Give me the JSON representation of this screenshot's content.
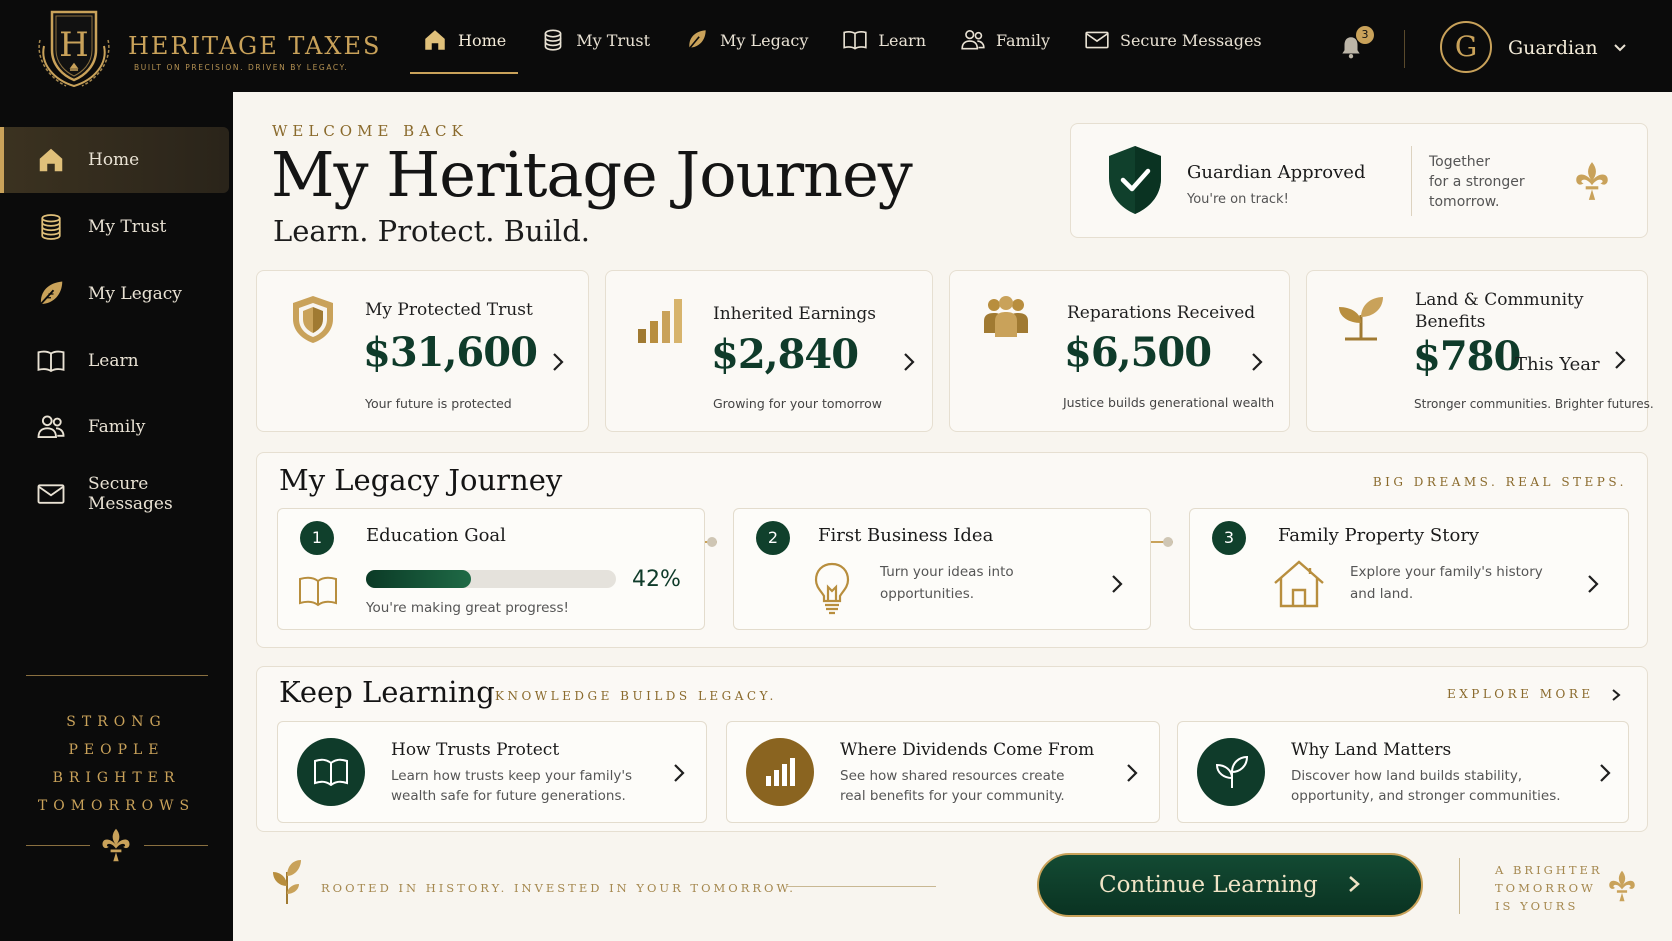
{
  "brand": {
    "letter": "H",
    "name": "HERITAGE TAXES",
    "tagline": "BUILT ON PRECISION. DRIVEN BY LEGACY."
  },
  "topnav": {
    "items": [
      {
        "label": "Home",
        "icon": "home-icon",
        "active": true
      },
      {
        "label": "My Trust",
        "icon": "coins-icon"
      },
      {
        "label": "My Legacy",
        "icon": "leaf-icon"
      },
      {
        "label": "Learn",
        "icon": "book-icon"
      },
      {
        "label": "Family",
        "icon": "family-icon"
      },
      {
        "label": "Secure Messages",
        "icon": "mail-icon"
      }
    ],
    "notification_count": "3",
    "user_initial": "G",
    "user_name": "Guardian"
  },
  "sidebar": {
    "items": [
      {
        "label": "Home",
        "icon": "home-icon",
        "active": true
      },
      {
        "label": "My Trust",
        "icon": "coins-icon"
      },
      {
        "label": "My Legacy",
        "icon": "leaf-icon"
      },
      {
        "label": "Learn",
        "icon": "book-icon"
      },
      {
        "label": "Family",
        "icon": "family-icon"
      },
      {
        "label": "Secure Messages",
        "icon": "mail-icon"
      }
    ],
    "motto": [
      "STRONG",
      "PEOPLE",
      "BRIGHTER",
      "TOMORROWS"
    ]
  },
  "header": {
    "eyebrow": "WELCOME BACK",
    "title": "My Heritage Journey",
    "subtitle": "Learn. Protect. Build."
  },
  "approved": {
    "title": "Guardian Approved",
    "subtitle": "You're on track!",
    "motto": [
      "Together",
      "for a stronger",
      "tomorrow."
    ]
  },
  "stats": [
    {
      "label": "My Protected Trust",
      "value": "$31,600",
      "caption": "Your future is protected",
      "icon": "shield-icon"
    },
    {
      "label": "Inherited Earnings",
      "value": "$2,840",
      "caption": "Growing for your tomorrow",
      "icon": "bar-chart-icon"
    },
    {
      "label": "Reparations Received",
      "value": "$6,500",
      "caption": "Justice builds generational wealth",
      "icon": "people-icon"
    },
    {
      "label": "Land & Community Benefits",
      "value": "$780",
      "suffix": "This Year",
      "caption": "Stronger communities. Brighter futures.",
      "icon": "sprout-icon"
    }
  ],
  "journey": {
    "title": "My Legacy Journey",
    "eyebrow": "BIG DREAMS. REAL STEPS.",
    "steps": [
      {
        "number": "1",
        "title": "Education Goal",
        "progress": 0.42,
        "progress_label": "42%",
        "caption": "You're making great progress!",
        "icon": "book-icon"
      },
      {
        "number": "2",
        "title": "First Business Idea",
        "desc": "Turn your ideas into opportunities.",
        "icon": "lightbulb-icon"
      },
      {
        "number": "3",
        "title": "Family Property Story",
        "desc": "Explore your family's history and land.",
        "icon": "house-icon"
      }
    ]
  },
  "learning": {
    "title": "Keep Learning",
    "eyebrow": "KNOWLEDGE BUILDS LEGACY.",
    "explore": "EXPLORE MORE",
    "cards": [
      {
        "title": "How Trusts Protect",
        "desc": "Learn how trusts keep your family's wealth safe for future generations.",
        "icon": "book-icon",
        "color": "#0f3b2a"
      },
      {
        "title": "Where Dividends Come From",
        "desc": "See how shared resources create real benefits for your community.",
        "icon": "bar-chart-icon",
        "color": "#8a6420"
      },
      {
        "title": "Why Land Matters",
        "desc": "Discover how land builds stability, opportunity, and stronger communities.",
        "icon": "sprout-icon",
        "color": "#0f3b2a"
      }
    ]
  },
  "footer": {
    "motto": "ROOTED IN HISTORY. INVESTED IN YOUR TOMORROW.",
    "button": "Continue Learning",
    "tagline": [
      "A BRIGHTER",
      "TOMORROW",
      "IS YOURS"
    ]
  },
  "colors": {
    "gold": "#c9a25a",
    "green": "#0f3b2a",
    "dark": "#0b0b0b",
    "cream": "#f8f5ef"
  }
}
